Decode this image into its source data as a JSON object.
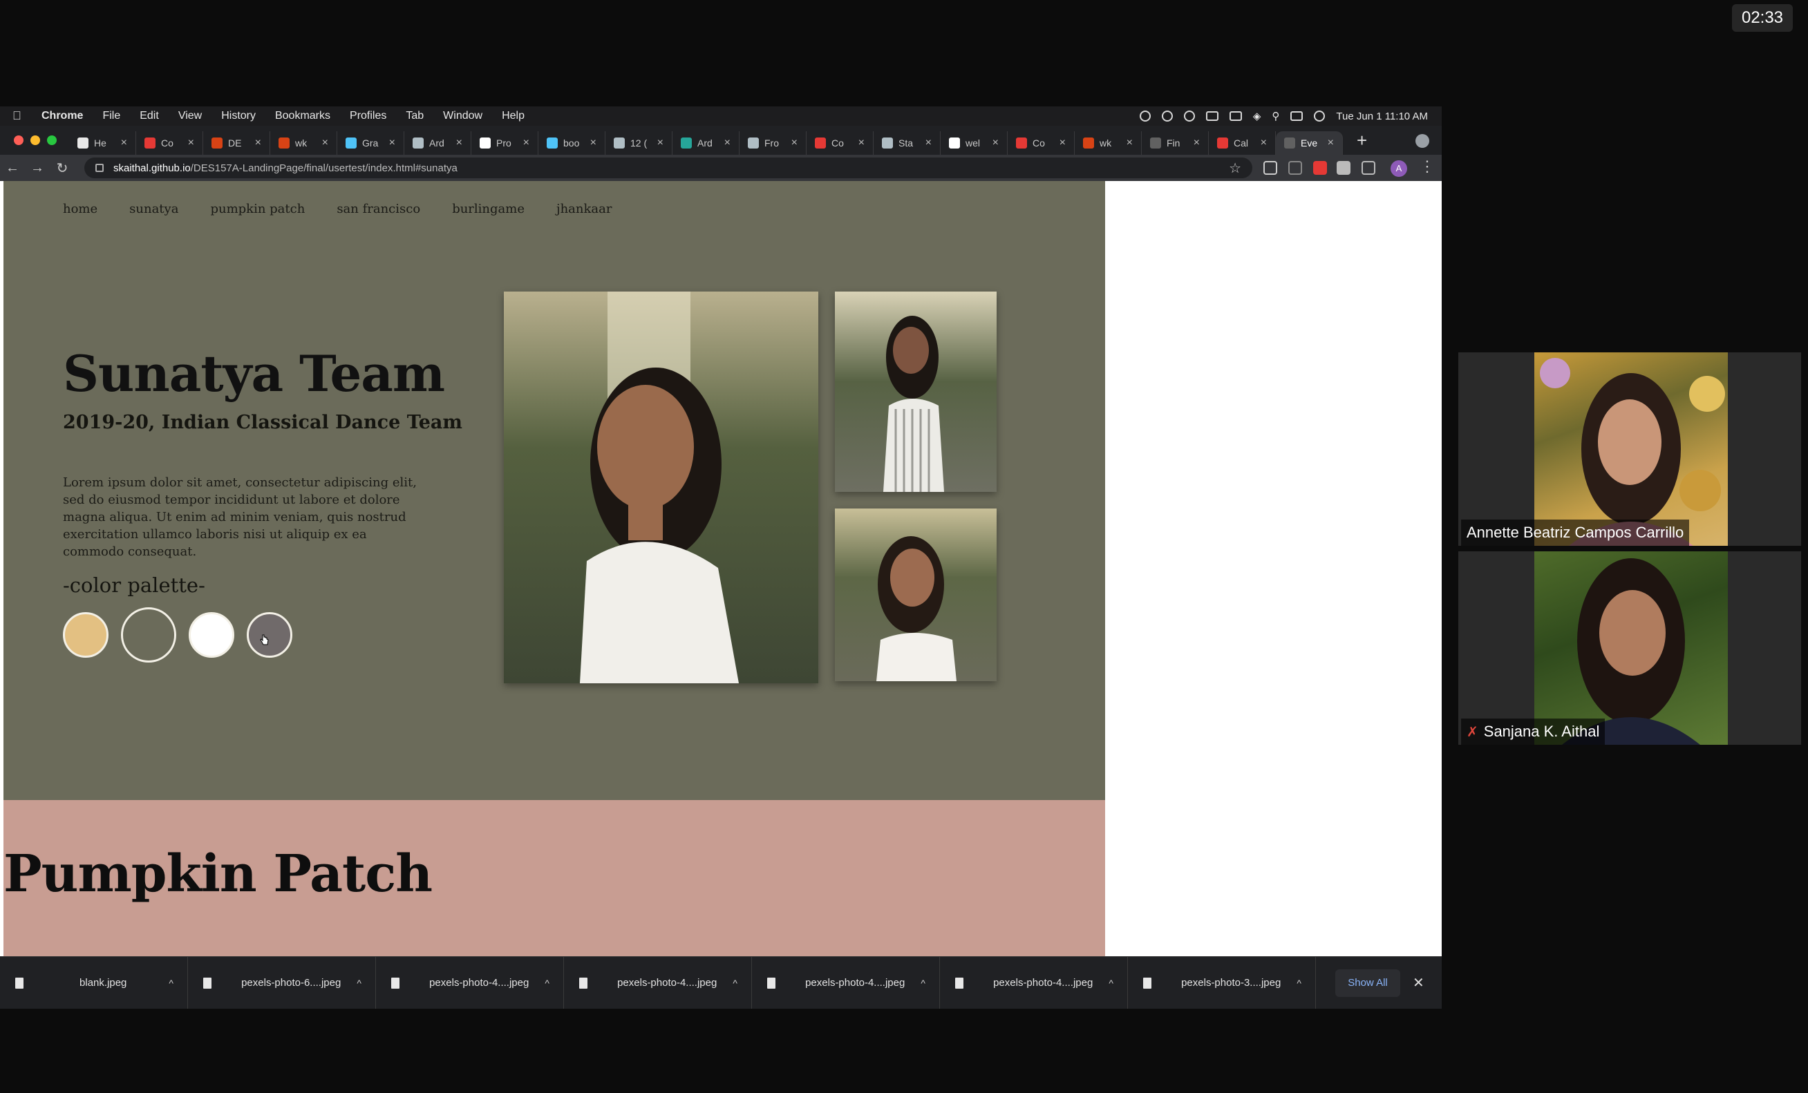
{
  "timer": "02:33",
  "menubar": {
    "items": [
      "Chrome",
      "File",
      "Edit",
      "View",
      "History",
      "Bookmarks",
      "Profiles",
      "Tab",
      "Window",
      "Help"
    ],
    "datetime": "Tue Jun 1  11:10 AM"
  },
  "tabs": [
    {
      "title": "He",
      "color": "#e8e8e8"
    },
    {
      "title": "Co",
      "color": "#e53935"
    },
    {
      "title": "DE",
      "color": "#d84315"
    },
    {
      "title": "wk",
      "color": "#d84315"
    },
    {
      "title": "Gra",
      "color": "#4fc3f7"
    },
    {
      "title": "Ard",
      "color": "#b0bec5"
    },
    {
      "title": "Pro",
      "color": "#ffffff"
    },
    {
      "title": "boo",
      "color": "#4fc3f7"
    },
    {
      "title": "12 (",
      "color": "#b0bec5"
    },
    {
      "title": "Ard",
      "color": "#26a69a"
    },
    {
      "title": "Fro",
      "color": "#b0bec5"
    },
    {
      "title": "Co",
      "color": "#e53935"
    },
    {
      "title": "Sta",
      "color": "#b0bec5"
    },
    {
      "title": "wel",
      "color": "#ffffff"
    },
    {
      "title": "Co",
      "color": "#e53935"
    },
    {
      "title": "wk",
      "color": "#d84315"
    },
    {
      "title": "Fin",
      "color": "#616161"
    },
    {
      "title": "Cal",
      "color": "#e53935"
    },
    {
      "title": "Eve",
      "color": "#616161"
    }
  ],
  "url": {
    "host": "skaithal.github.io",
    "path": "/DES157A-LandingPage/final/usertest/index.html#sunatya"
  },
  "profile_initial": "A",
  "site": {
    "nav": [
      "home",
      "sunatya",
      "pumpkin patch",
      "san francisco",
      "burlingame",
      "jhankaar"
    ],
    "title": "Sunatya Team",
    "subtitle": "2019-20, Indian Classical Dance Team",
    "body": "Lorem ipsum dolor sit amet, consectetur adipiscing elit, sed do eiusmod tempor incididunt ut labore et dolore magna aliqua. Ut enim ad minim veniam, quis nostrud exercitation ullamco laboris nisi ut aliquip ex ea commodo consequat.",
    "palette_label": "-color palette-",
    "palette": [
      "#e3c082",
      "#6b6b5a",
      "#ffffff",
      "#706a6a"
    ],
    "next_section_title": "Pumpkin Patch"
  },
  "downloads": {
    "files": [
      "blank.jpeg",
      "pexels-photo-6....jpeg",
      "pexels-photo-4....jpeg",
      "pexels-photo-4....jpeg",
      "pexels-photo-4....jpeg",
      "pexels-photo-4....jpeg",
      "pexels-photo-3....jpeg"
    ],
    "show_all": "Show All"
  },
  "participants": [
    {
      "name": "Annette Beatriz Campos Carrillo",
      "muted": false
    },
    {
      "name": "Sanjana K. Aithal",
      "muted": true
    }
  ]
}
